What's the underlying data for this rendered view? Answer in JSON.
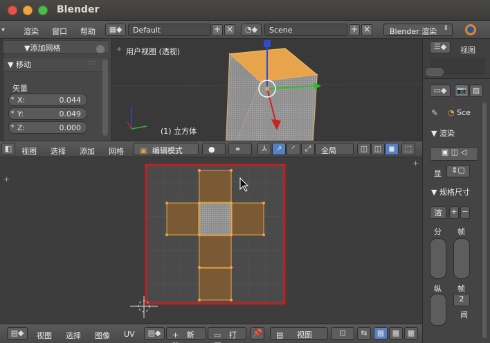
{
  "window": {
    "title": "Blender"
  },
  "top_header": {
    "menus": [
      "渲染",
      "窗口",
      "帮助"
    ],
    "layout": "Default",
    "scene": "Scene",
    "render_engine": "Blender 渲染"
  },
  "tool_shelf": {
    "panel_add_mesh": "▼添加网格",
    "panel_move": "▼ 移动",
    "vector_label": "矢量",
    "vector": [
      {
        "label": "X:",
        "value": "0.044"
      },
      {
        "label": "Y:",
        "value": "0.049"
      },
      {
        "label": "Z:",
        "value": "0.000"
      }
    ]
  },
  "viewport": {
    "label": "用户视图 (透视)",
    "object": "(1) 立方体"
  },
  "viewport_header": {
    "menus": [
      "视图",
      "选择",
      "添加",
      "网格"
    ],
    "mode": "编辑模式",
    "pivot": "全局"
  },
  "uv_header": {
    "menus": [
      "视图",
      "选择",
      "图像",
      "UV"
    ],
    "new_label": "新建",
    "open_label": "打开",
    "view_label": "视图"
  },
  "outliner": {
    "view_label": "视图"
  },
  "properties": {
    "scene_label": "Sce",
    "render_section": "▼ 渲染",
    "display_label": "显",
    "dimensions_section": "▼ 规格尺寸",
    "preset_label": "渲",
    "res_label": "分",
    "frame_label": "帧",
    "aspect_label": "纵",
    "frame_label2": "帧",
    "frame_value": "2",
    "interval_label": "间"
  },
  "colors": {
    "accent_orange": "#e7a44a",
    "uv_border_red": "#c41f1f"
  }
}
